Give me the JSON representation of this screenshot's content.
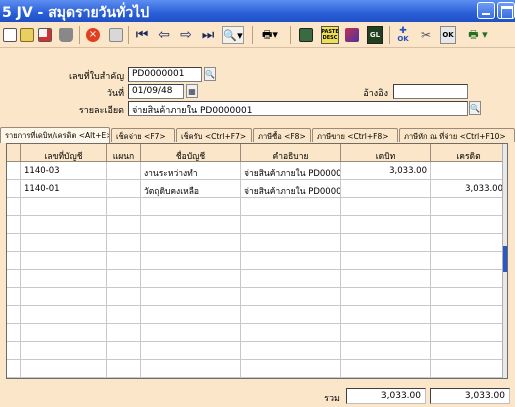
{
  "window": {
    "title": "5 JV - สมุดรายวันทั่วไป"
  },
  "toolbar": {
    "icons": [
      "new-icon",
      "open-icon",
      "edit-icon",
      "delete-icon",
      "cancel-icon",
      "save-icon",
      "first-icon",
      "prev-icon",
      "next-icon",
      "last-icon",
      "search-icon",
      "print-icon",
      "report-icon",
      "paste-desc-icon",
      "color-icon",
      "gl-icon",
      "ok-icon",
      "clear-icon",
      "ok-confirm-icon",
      "printer-dropdown-icon"
    ],
    "paste_desc_label": "PASTE DESC",
    "ok_label": "OK",
    "gl_label": "GL"
  },
  "form": {
    "doc_no_label": "เลขที่ใบสำคัญ",
    "doc_no_value": "PD0000001",
    "date_label": "วันที่",
    "date_value": "01/09/48",
    "ref_label": "อ้างอิง",
    "ref_value": "",
    "desc_label": "รายละเอียด",
    "desc_value": "จ่ายสินค้าภายใน PD0000001"
  },
  "tabs": [
    {
      "label": "รายการที่เดบิท/เครดิต <Alt+E>"
    },
    {
      "label": "เช็คจ่าย <F7>"
    },
    {
      "label": "เช็ครับ <Ctrl+F7>"
    },
    {
      "label": "ภาษีซื้อ <F8>"
    },
    {
      "label": "ภาษีขาย <Ctrl+F8>"
    },
    {
      "label": "ภาษีหัก ณ ที่จ่าย <Ctrl+F10>"
    }
  ],
  "grid": {
    "headers": [
      "เลขที่บัญชี",
      "แผนก",
      "ชื่อบัญชี",
      "คำอธิบาย",
      "เดบิท",
      "เครดิต"
    ],
    "rows": [
      {
        "account": "1140-03",
        "dept": "",
        "name": "งานระหว่างทำ",
        "desc": "จ่ายสินค้าภายใน PD00000",
        "debit": "3,033.00",
        "credit": ""
      },
      {
        "account": "1140-01",
        "dept": "",
        "name": "วัตถุดิบคงเหลือ",
        "desc": "จ่ายสินค้าภายใน PD00000",
        "debit": "",
        "credit": "3,033.00"
      }
    ]
  },
  "footer": {
    "total_label": "รวม",
    "total_debit": "3,033.00",
    "total_credit": "3,033.00"
  },
  "colors": {
    "background": "#fbe6c9",
    "titlebar": "#2a5fd8"
  }
}
